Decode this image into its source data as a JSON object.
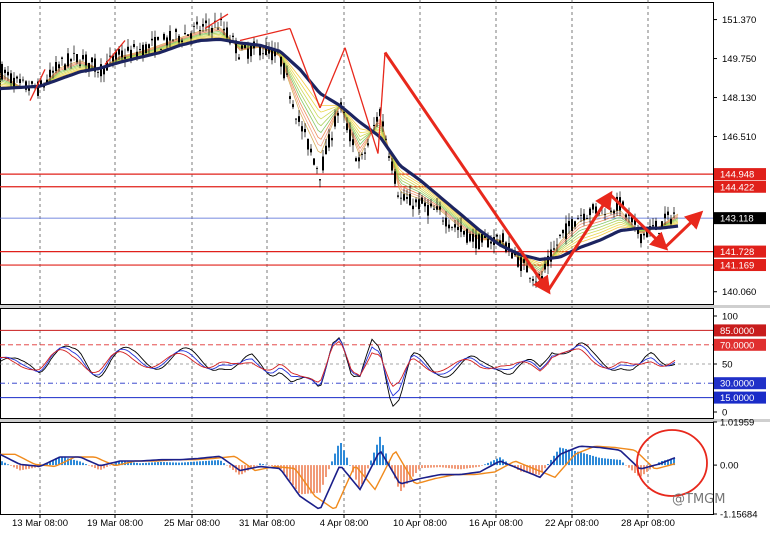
{
  "colors": {
    "candle": "#000000",
    "price_line": "#4a63d6",
    "thick_ma": "#1c2460",
    "resistance": "#e0201a",
    "arrow": "#e8281c",
    "rsi_black": "#000000",
    "rsi_blue": "#2433d9",
    "rsi_red": "#d32020",
    "macd_hist_pos": "#2e8ad8",
    "macd_hist_neg": "#f19a78",
    "macd_line": "#1b1f8a",
    "signal_line": "#f08a1c",
    "level_85": "#c81c1c",
    "level_70": "#e03030",
    "level_30": "#2030c8",
    "level_15": "#1a2cc8",
    "grid": "#000000"
  },
  "watermark": "@TMGM",
  "chart_data": [
    {
      "type": "line",
      "panel": "price",
      "y_ticks": [
        "151.370",
        "149.750",
        "148.130",
        "146.510",
        "140.060"
      ],
      "ylim": [
        139.55,
        152.1
      ],
      "horizontal_levels": [
        {
          "label": "144.948",
          "value": 144.948,
          "kind": "resistance"
        },
        {
          "label": "144.422",
          "value": 144.422,
          "kind": "resistance"
        },
        {
          "label": "143.118",
          "value": 143.118,
          "kind": "current"
        },
        {
          "label": "141.728",
          "value": 141.728,
          "kind": "resistance"
        },
        {
          "label": "141.169",
          "value": 141.169,
          "kind": "resistance"
        }
      ],
      "x": [
        0,
        20,
        40,
        60,
        80,
        100,
        120,
        140,
        160,
        180,
        200,
        220,
        240,
        260,
        280,
        300,
        320,
        340,
        360,
        380,
        400,
        420,
        440,
        460,
        480,
        500,
        520,
        540,
        560,
        580,
        600,
        620,
        640,
        660,
        680
      ],
      "close": [
        149.3,
        148.6,
        148.5,
        149.5,
        149.8,
        149.3,
        149.9,
        150.1,
        150.4,
        150.7,
        151.0,
        151.2,
        150.0,
        150.2,
        149.8,
        147.0,
        145.0,
        147.8,
        145.3,
        147.6,
        143.9,
        143.7,
        143.3,
        142.6,
        142.1,
        142.3,
        141.3,
        140.5,
        142.3,
        143.3,
        143.5,
        143.7,
        142.4,
        142.8,
        143.5
      ],
      "ma_thick": [
        148.5,
        148.55,
        148.6,
        148.9,
        149.2,
        149.35,
        149.6,
        149.8,
        150.0,
        150.3,
        150.5,
        150.55,
        150.4,
        150.3,
        150.05,
        149.3,
        148.3,
        147.8,
        147.1,
        146.5,
        145.3,
        144.7,
        144.0,
        143.3,
        142.6,
        142.0,
        141.6,
        141.4,
        141.5,
        141.9,
        142.2,
        142.6,
        142.7,
        142.7,
        142.8
      ],
      "zigzag_segments": [
        [
          [
            30,
            148.0
          ],
          [
            45,
            149.3
          ]
        ],
        [
          [
            105,
            149.5
          ],
          [
            125,
            150.5
          ]
        ],
        [
          [
            205,
            151.0
          ],
          [
            228,
            151.6
          ]
        ],
        [
          [
            240,
            150.5
          ],
          [
            290,
            151.0
          ]
        ],
        [
          [
            290,
            151.0
          ],
          [
            320,
            147.7
          ]
        ],
        [
          [
            320,
            147.7
          ],
          [
            345,
            150.2
          ]
        ],
        [
          [
            345,
            150.2
          ],
          [
            378,
            145.8
          ]
        ],
        [
          [
            378,
            145.8
          ],
          [
            385,
            150.0
          ]
        ]
      ],
      "arrows": [
        [
          [
            385,
            150.0
          ],
          [
            548,
            140.1
          ]
        ],
        [
          [
            548,
            140.1
          ],
          [
            610,
            144.1
          ]
        ],
        [
          [
            610,
            144.1
          ],
          [
            665,
            141.9
          ]
        ],
        [
          [
            665,
            141.9
          ],
          [
            700,
            143.3
          ]
        ]
      ]
    },
    {
      "type": "line",
      "panel": "rsi",
      "y_ticks": [
        "100",
        "85.0000",
        "70.0000",
        "50",
        "30.0000",
        "15.0000",
        "0"
      ],
      "ylim": [
        0,
        100
      ],
      "levels": [
        85,
        70,
        50,
        30,
        15
      ]
    },
    {
      "type": "bar",
      "panel": "macd",
      "y_ticks": [
        "1.01959",
        "0.00",
        "-1.15684"
      ],
      "ylim": [
        -1.15684,
        1.01959
      ]
    }
  ],
  "x_ticks": [
    "13 Mar 08:00",
    "19 Mar 08:00",
    "25 Mar 08:00",
    "31 Mar 08:00",
    "4 Apr 08:00",
    "10 Apr 08:00",
    "16 Apr 08:00",
    "22 Apr 08:00",
    "28 Apr 08:00"
  ]
}
